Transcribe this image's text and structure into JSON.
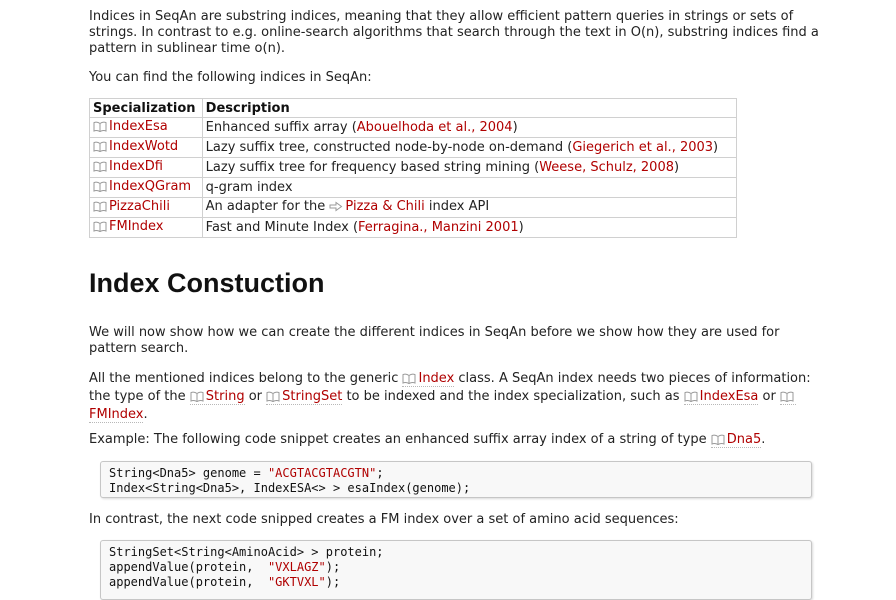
{
  "intro": {
    "p1": "Indices in SeqAn are substring indices, meaning that they allow efficient pattern queries in strings or sets of strings. In contrast to e.g. online-search algorithms that search through the text in O(n), substring indices find a pattern in sublinear time o(n).",
    "p2": "You can find the following indices in SeqAn:"
  },
  "table": {
    "headers": [
      "Specialization",
      "Description"
    ],
    "rows": [
      {
        "name": "IndexEsa",
        "pre": "Enhanced suffix array (",
        "ref": "Abouelhoda et al., 2004",
        "post": ")"
      },
      {
        "name": "IndexWotd",
        "pre": "Lazy suffix tree, constructed node-by-node on-demand (",
        "ref": "Giegerich et al., 2003",
        "post": ")"
      },
      {
        "name": "IndexDfi",
        "pre": "Lazy suffix tree for frequency based string mining (",
        "ref": "Weese, Schulz, 2008",
        "post": ")"
      },
      {
        "name": "IndexQGram",
        "pre": "q-gram index",
        "ref": "",
        "post": ""
      },
      {
        "name": "PizzaChili",
        "pre": "An adapter for the ",
        "ref": "Pizza & Chili",
        "post": " index API"
      },
      {
        "name": "FMIndex",
        "pre": "Fast and Minute Index (",
        "ref": "Ferragina., Manzini 2001",
        "post": ")"
      }
    ]
  },
  "section": {
    "title": "Index Constuction",
    "p3": "We will now show how we can create the different indices in SeqAn before we show how they are used for pattern search.",
    "p4": {
      "t1": "All the mentioned indices belong to the generic ",
      "l1": "Index",
      "t2": " class. A SeqAn index needs two pieces of information: the type of the ",
      "l2": "String",
      "t3": " or ",
      "l3": "StringSet",
      "t4": " to be indexed and the index specialization, such as ",
      "l4": "IndexEsa",
      "t5": " or ",
      "l5": "FMIndex",
      "t6": "."
    },
    "p5": {
      "t1": "Example: The following code snippet creates an enhanced suffix array index of a string of type ",
      "l1": "Dna5",
      "t2": "."
    },
    "p6": "In contrast, the next code snipped creates a FM index over a set of amino acid sequences:"
  },
  "code1": {
    "l1a": "String<Dna5> genome = ",
    "l1s": "\"ACGTACGTACGTN\"",
    "l1b": ";",
    "l2": "Index<String<Dna5>, IndexESA<> > esaIndex(genome);"
  },
  "code2": {
    "l1": "StringSet<String<AminoAcid> > protein;",
    "l2a": "appendValue(protein,  ",
    "l2s": "\"VXLAGZ\"",
    "l2b": ");",
    "l3a": "appendValue(protein,  ",
    "l3s": "\"GKTVXL\"",
    "l3b": ");"
  },
  "icons": {
    "class_link": "book-icon",
    "external_link": "arrow-right-icon"
  },
  "colors": {
    "link": "#b00000",
    "text": "#222222",
    "code_bg": "#f8f8f8"
  }
}
